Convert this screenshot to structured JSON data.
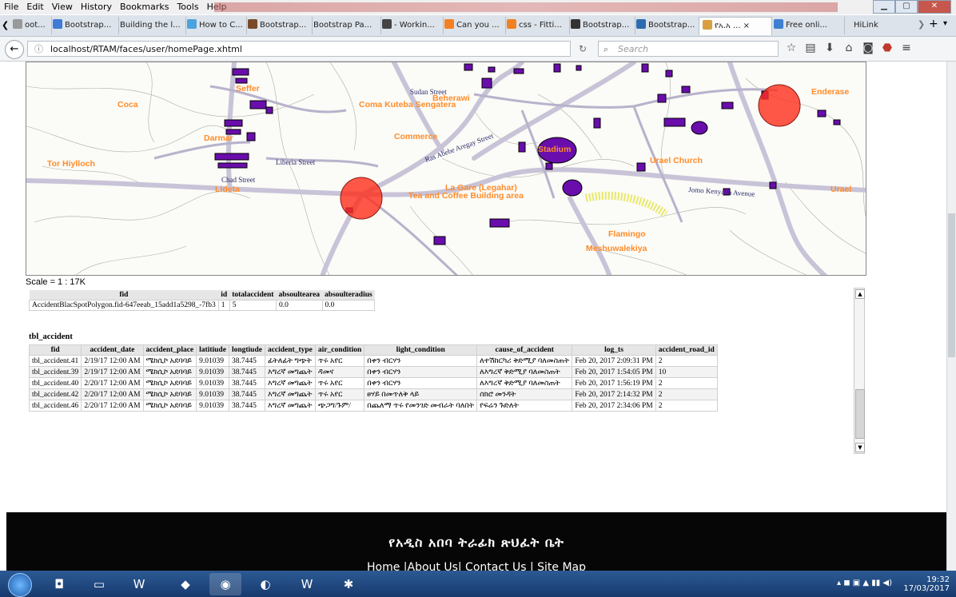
{
  "menu": [
    "File",
    "Edit",
    "View",
    "History",
    "Bookmarks",
    "Tools",
    "Help"
  ],
  "tabs": [
    {
      "label": "oot...",
      "color": "#888888"
    },
    {
      "label": "Bootstrap...",
      "color": "#3d7bd6"
    },
    {
      "label": "Building the l...",
      "color": "#aaaaaa"
    },
    {
      "label": "How to C...",
      "color": "#4aa3df"
    },
    {
      "label": "Bootstrap...",
      "color": "#7a4a2a"
    },
    {
      "label": "Bootstrap Pa...",
      "color": "#bbbbbb"
    },
    {
      "label": "- Workin...",
      "color": "#444444"
    },
    {
      "label": "Can you ...",
      "color": "#f48024"
    },
    {
      "label": "css - Fitti...",
      "color": "#f48024"
    },
    {
      "label": "Bootstrap...",
      "color": "#333333"
    },
    {
      "label": "Bootstrap...",
      "color": "#2b6cb0"
    },
    {
      "label": "የአ.አ ... ×",
      "color": "#d9a040"
    },
    {
      "label": "Free onli...",
      "color": "#3f7fd1"
    },
    {
      "label": "HiLink",
      "color": "#dde3ea"
    }
  ],
  "url": "localhost/RTAM/faces/user/homePage.xhtml",
  "search_placeholder": "Search",
  "map_labels": [
    {
      "text": "Coca"
    },
    {
      "text": "Seffer"
    },
    {
      "text": "Darmar"
    },
    {
      "text": "Tor Hiylloch"
    },
    {
      "text": "Lideta"
    },
    {
      "text": "Coma Kuteba Sengatera"
    },
    {
      "text": "Commerce"
    },
    {
      "text": "Beherawi"
    },
    {
      "text": "Stadium"
    },
    {
      "text": "Urael Church"
    },
    {
      "text": "Enderase"
    },
    {
      "text": "Urael"
    },
    {
      "text": "Flamingo"
    },
    {
      "text": "Meshuwalekiya"
    },
    {
      "text": "Tea and Coffee Building area"
    },
    {
      "text": "La Gare (Legahar)"
    }
  ],
  "street_labels": [
    "Liberia Street",
    "Chad Street",
    "Sudan Street",
    "Ras Abebe Aregay Street",
    "Jomo Kenyatta Avenue"
  ],
  "scale_text": "Scale = 1 : 17K",
  "polygon_table": {
    "headers": [
      "fid",
      "id",
      "totalaccident",
      "absoultearea",
      "absoulteradius"
    ],
    "rows": [
      [
        "AccidentBlacSpotPolygon.fid-647eeab_15add1a5298_-7fb3",
        "1",
        "5",
        "0.0",
        "0.0"
      ]
    ]
  },
  "accident_caption": "tbl_accident",
  "accident_table": {
    "headers": [
      "fid",
      "accident_date",
      "accident_place",
      "latitiude",
      "longtiude",
      "accident_type",
      "air_condition",
      "light_condition",
      "cause_of_accident",
      "log_ts",
      "accident_road_id"
    ],
    "rows": [
      [
        "tbl_accident.41",
        "2/19/17 12:00 AM",
        "ሜክሲኮ አደባባይ",
        "9.01039",
        "38.7445",
        "ፊትለፊት ግጭት",
        "ጥሩ አየር",
        "በቀን ብርሃን",
        "ለተሽከርካሪ ቅድሚያ ባለመስጠት",
        "Feb 20, 2017 2:09:31 PM",
        "2"
      ],
      [
        "tbl_accident.39",
        "2/19/17 12:00 AM",
        "ሜክሲኮ አደባባይ",
        "9.01039",
        "38.7445",
        "እግረኛ መግጨት",
        "ዳመና",
        "በቀን ብርሃን",
        "ለእግረኛ ቅድሚያ ባለመስጠት",
        "Feb 20, 2017 1:54:05 PM",
        "10"
      ],
      [
        "tbl_accident.40",
        "2/20/17 12:00 AM",
        "ሜክሲኮ አደባባይ",
        "9.01039",
        "38.7445",
        "እግረኛ መግጨት",
        "ጥሩ አየር",
        "በቀን ብርሃን",
        "ለእግረኛ ቅድሚያ ባለመስጠት",
        "Feb 20, 2017 1:56:19 PM",
        "2"
      ],
      [
        "tbl_accident.42",
        "2/20/17 12:00 AM",
        "ሜክሲኮ አደባባይ",
        "9.01039",
        "38.7445",
        "እግረኛ መግጨት",
        "ጥሩ አየር",
        "ፀሃይ በመጥለቅ ላይ",
        "ሰክሮ መንዳት",
        "Feb 20, 2017 2:14:32 PM",
        "2"
      ],
      [
        "tbl_accident.46",
        "2/20/17 12:00 AM",
        "ሜክሲኮ አደባባይ",
        "9.01039",
        "38.7445",
        "እግረኛ መግጨት",
        "ጭጋግ/ጉም/",
        "በጨለማ ጥሩ የመንገድ መብራት ባለበት",
        "የፍሬን ጉድለት",
        "Feb 20, 2017 2:34:06 PM",
        "2"
      ]
    ]
  },
  "footer": {
    "title": "የአዲስ አበባ ትራፊክ ጽህፈት ቤት",
    "links": "Home |About Us| Contact Us | Site Map"
  },
  "clock": {
    "time": "19:32",
    "date": "17/03/2017"
  }
}
